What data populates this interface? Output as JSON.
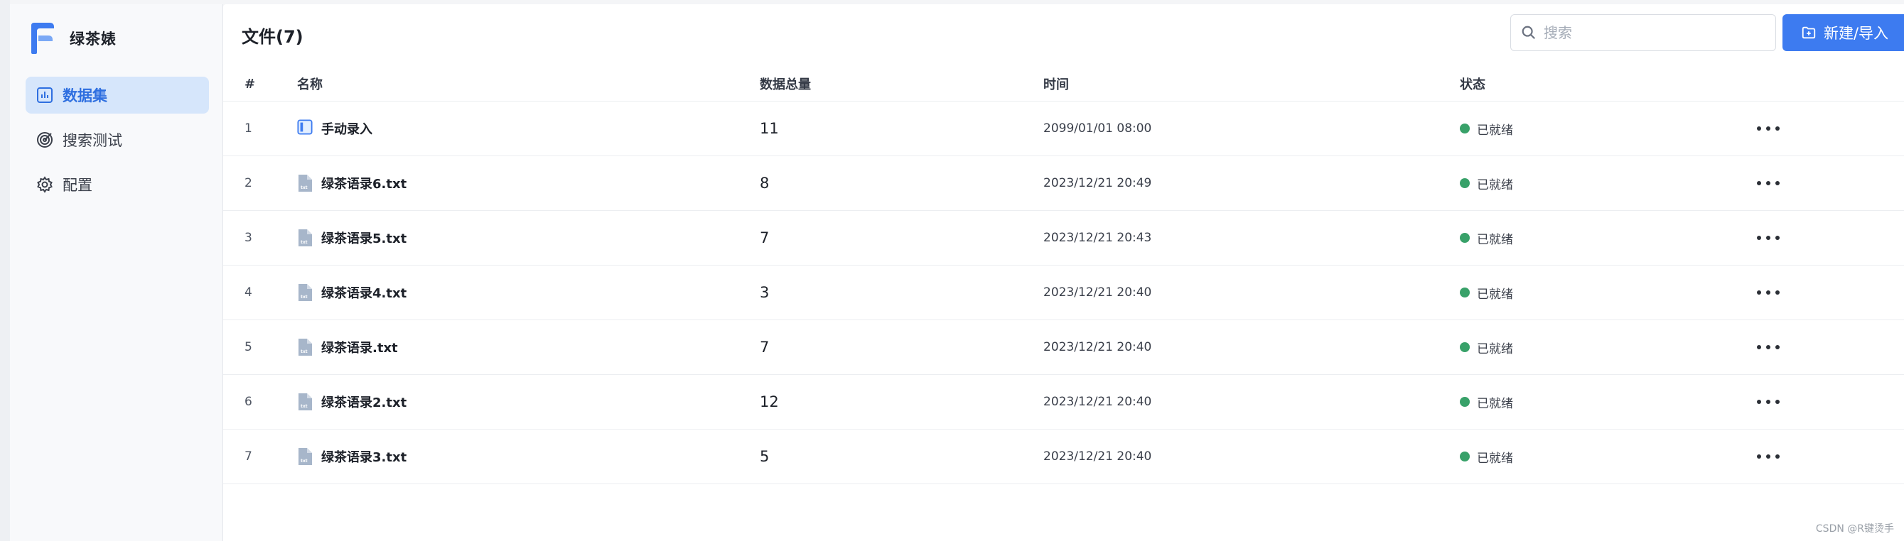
{
  "app": {
    "title": "绿茶婊"
  },
  "sidebar": {
    "items": [
      {
        "label": "数据集",
        "icon": "chart-icon",
        "active": true
      },
      {
        "label": "搜索测试",
        "icon": "target-icon",
        "active": false
      },
      {
        "label": "配置",
        "icon": "gear-icon",
        "active": false
      }
    ]
  },
  "header": {
    "title": "文件(7)",
    "search_placeholder": "搜索",
    "new_button_label": "新建/导入"
  },
  "table": {
    "columns": [
      "#",
      "名称",
      "数据总量",
      "时间",
      "状态"
    ],
    "rows": [
      {
        "idx": "1",
        "name": "手动录入",
        "count": "11",
        "time": "2099/01/01 08:00",
        "status": "已就绪",
        "icon": "manual-entry-icon"
      },
      {
        "idx": "2",
        "name": "绿茶语录6.txt",
        "count": "8",
        "time": "2023/12/21 20:49",
        "status": "已就绪",
        "icon": "txt-file-icon"
      },
      {
        "idx": "3",
        "name": "绿茶语录5.txt",
        "count": "7",
        "time": "2023/12/21 20:43",
        "status": "已就绪",
        "icon": "txt-file-icon"
      },
      {
        "idx": "4",
        "name": "绿茶语录4.txt",
        "count": "3",
        "time": "2023/12/21 20:40",
        "status": "已就绪",
        "icon": "txt-file-icon"
      },
      {
        "idx": "5",
        "name": "绿茶语录.txt",
        "count": "7",
        "time": "2023/12/21 20:40",
        "status": "已就绪",
        "icon": "txt-file-icon"
      },
      {
        "idx": "6",
        "name": "绿茶语录2.txt",
        "count": "12",
        "time": "2023/12/21 20:40",
        "status": "已就绪",
        "icon": "txt-file-icon"
      },
      {
        "idx": "7",
        "name": "绿茶语录3.txt",
        "count": "5",
        "time": "2023/12/21 20:40",
        "status": "已就绪",
        "icon": "txt-file-icon"
      }
    ]
  },
  "watermark": "CSDN @R键烫手",
  "colors": {
    "accent": "#3d7bf0",
    "active_bg": "#d6e6fb",
    "status_ready": "#38a169"
  }
}
